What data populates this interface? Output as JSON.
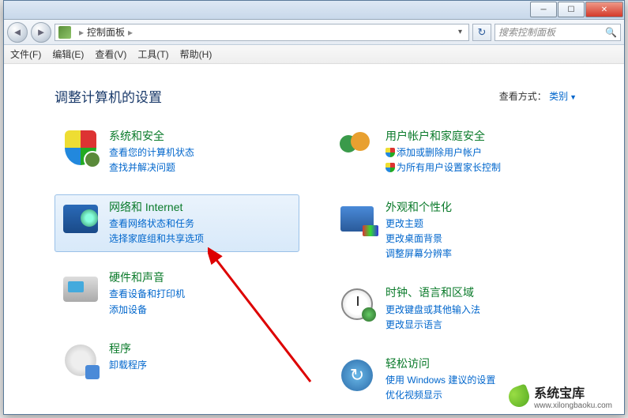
{
  "window": {
    "breadcrumb": "控制面板",
    "search_placeholder": "搜索控制面板"
  },
  "menu": {
    "file": "文件(F)",
    "edit": "编辑(E)",
    "view": "查看(V)",
    "tools": "工具(T)",
    "help": "帮助(H)"
  },
  "page": {
    "heading": "调整计算机的设置",
    "viewby_label": "查看方式：",
    "viewby_value": "类别"
  },
  "categories": {
    "left": [
      {
        "title": "系统和安全",
        "links": [
          "查看您的计算机状态",
          "查找并解决问题"
        ],
        "icon": "shield"
      },
      {
        "title": "网络和 Internet",
        "links": [
          "查看网络状态和任务",
          "选择家庭组和共享选项"
        ],
        "icon": "net",
        "selected": true
      },
      {
        "title": "硬件和声音",
        "links": [
          "查看设备和打印机",
          "添加设备"
        ],
        "icon": "hw"
      },
      {
        "title": "程序",
        "links": [
          "卸载程序"
        ],
        "icon": "prog"
      }
    ],
    "right": [
      {
        "title": "用户帐户和家庭安全",
        "links": [
          "添加或删除用户帐户",
          "为所有用户设置家长控制"
        ],
        "shields": [
          true,
          true
        ],
        "icon": "users"
      },
      {
        "title": "外观和个性化",
        "links": [
          "更改主题",
          "更改桌面背景",
          "调整屏幕分辨率"
        ],
        "icon": "appear"
      },
      {
        "title": "时钟、语言和区域",
        "links": [
          "更改键盘或其他输入法",
          "更改显示语言"
        ],
        "icon": "clock"
      },
      {
        "title": "轻松访问",
        "links": [
          "使用 Windows 建议的设置",
          "优化视频显示"
        ],
        "icon": "ease"
      }
    ]
  },
  "watermark": {
    "title": "系统宝库",
    "url": "www.xilongbaoku.com"
  }
}
